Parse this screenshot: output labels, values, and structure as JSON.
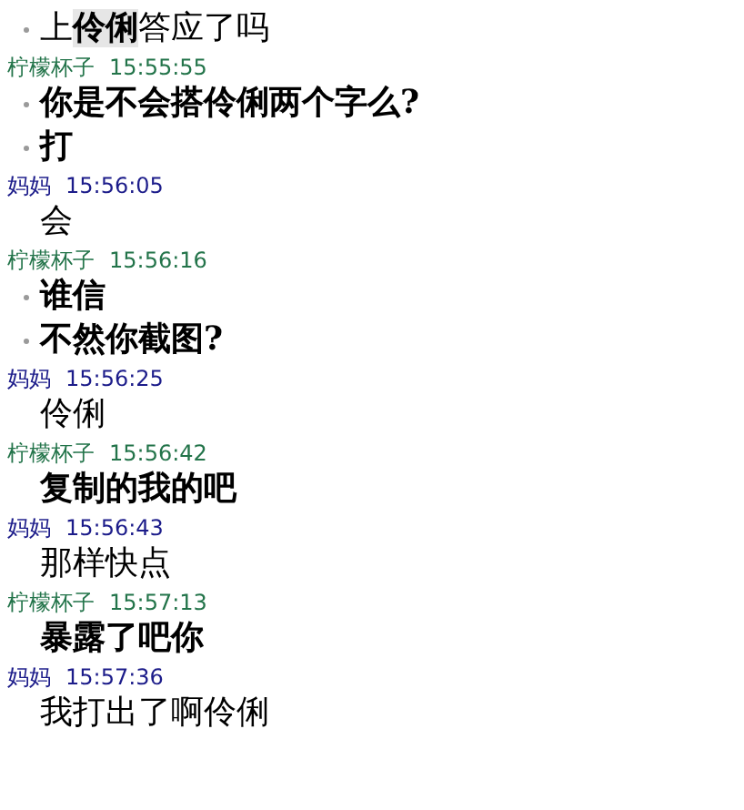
{
  "messages": [
    {
      "lines": [
        {
          "text": "上**伶俐**答应了吗",
          "bullet": true,
          "kind": "plain"
        }
      ]
    },
    {
      "sender": "柠檬杯子",
      "time": "15:55:55",
      "color": "#23744a",
      "lines": [
        {
          "text": "你是不会搭伶俐两个字么?",
          "bullet": true,
          "kind": "script"
        },
        {
          "text": "打",
          "bullet": true,
          "kind": "script"
        }
      ]
    },
    {
      "sender": "妈妈",
      "time": "15:56:05",
      "color": "#1c1c8a",
      "lines": [
        {
          "text": "会",
          "bullet": false,
          "kind": "plain"
        }
      ]
    },
    {
      "sender": "柠檬杯子",
      "time": "15:56:16",
      "color": "#23744a",
      "lines": [
        {
          "text": "谁信",
          "bullet": true,
          "kind": "script"
        },
        {
          "text": "不然你截图?",
          "bullet": true,
          "kind": "script"
        }
      ]
    },
    {
      "sender": "妈妈",
      "time": "15:56:25",
      "color": "#1c1c8a",
      "lines": [
        {
          "text": "伶俐",
          "bullet": false,
          "kind": "plain"
        }
      ]
    },
    {
      "sender": "柠檬杯子",
      "time": "15:56:42",
      "color": "#23744a",
      "lines": [
        {
          "text": "复制的我的吧",
          "bullet": false,
          "kind": "script"
        }
      ]
    },
    {
      "sender": "妈妈",
      "time": "15:56:43",
      "color": "#1c1c8a",
      "lines": [
        {
          "text": "那样快点",
          "bullet": false,
          "kind": "plain"
        }
      ]
    },
    {
      "sender": "柠檬杯子",
      "time": "15:57:13",
      "color": "#23744a",
      "lines": [
        {
          "text": "暴露了吧你",
          "bullet": false,
          "kind": "script"
        }
      ]
    },
    {
      "sender": "妈妈",
      "time": "15:57:36",
      "color": "#1c1c8a",
      "lines": [
        {
          "text": "我打出了啊伶俐",
          "bullet": false,
          "kind": "plain"
        }
      ]
    }
  ]
}
